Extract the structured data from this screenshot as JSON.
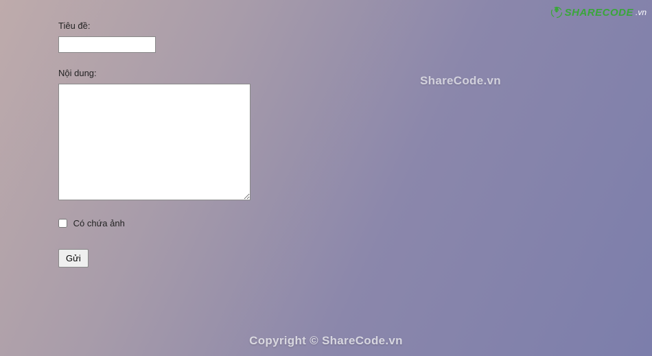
{
  "form": {
    "title_label": "Tiêu đề:",
    "title_value": "",
    "content_label": "Nội dung:",
    "content_value": "",
    "checkbox_label": "Có chứa ảnh",
    "submit_label": "Gửi"
  },
  "watermarks": {
    "center": "ShareCode.vn",
    "footer": "Copyright © ShareCode.vn"
  },
  "logo": {
    "brand_main": "SHARECODE",
    "brand_sub": ".vn"
  }
}
